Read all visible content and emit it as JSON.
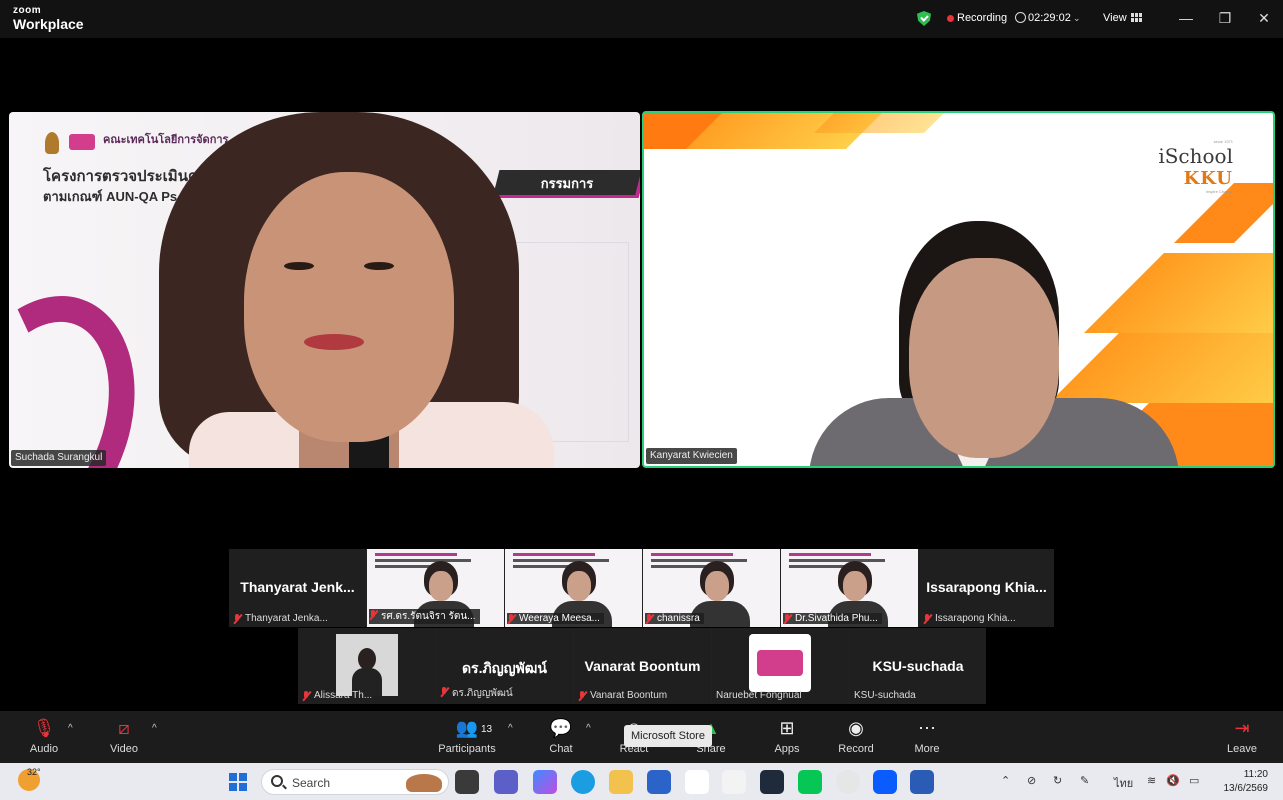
{
  "app": {
    "brand_top": "zoom",
    "brand_bottom": "Workplace"
  },
  "titlebar": {
    "recording_label": "Recording",
    "timer": "02:29:02",
    "view_label": "View",
    "minimize": "—",
    "restore": "❐",
    "close": "✕"
  },
  "main_tiles": [
    {
      "name": "Suchada Surangkul",
      "slide_faculty": "คณะเทคโนโลยีการจัดการ",
      "slide_line1": "โครงการตรวจประเมินคุณ",
      "slide_line1_tail": "s",
      "slide_line2": "ตามเกณฑ์ AUN-QA Ps",
      "badge": "กรรมการ"
    },
    {
      "name": "Kanyarat Kwiecien",
      "logo_small": "since 1971",
      "logo_line1": "iSchool",
      "logo_line2": "KKU",
      "logo_tag": "Inspire Change"
    }
  ],
  "strip_row1": [
    {
      "display": "Thanyarat  Jenk...",
      "label": "Thanyarat  Jenka..."
    },
    {
      "label": "รศ.ดร.รัตนจิรา รัตน..."
    },
    {
      "label": "Weeraya Meesa..."
    },
    {
      "label": "chanissra"
    },
    {
      "label": "Dr.Sivathida Phu..."
    },
    {
      "display": "Issarapong  Khia...",
      "label": "Issarapong  Khia..."
    }
  ],
  "strip_row2": [
    {
      "label": "Alissara Th..."
    },
    {
      "display": "ดร.ภิญญพัฒน์",
      "label": "ดร.ภิญญพัฒน์"
    },
    {
      "display": "Vanarat Boontum",
      "label": "Vanarat Boontum"
    },
    {
      "label": "Naruebet Fongnual"
    },
    {
      "display": "KSU-suchada",
      "label": "KSU-suchada"
    }
  ],
  "toolbar": {
    "audio": "Audio",
    "video": "Video",
    "participants": "Participants",
    "participants_count": "13",
    "chat": "Chat",
    "react": "React",
    "share": "Share",
    "apps": "Apps",
    "record": "Record",
    "more": "More",
    "leave": "Leave",
    "tooltip": "Microsoft Store"
  },
  "taskbar": {
    "temperature": "32°",
    "search_placeholder": "Search",
    "language": "ไทย",
    "time": "11:20",
    "date": "13/6/2569"
  },
  "colors": {
    "active_speaker_border": "#28d07a",
    "recording_dot": "#e8353b",
    "secure_shield": "#2fbf50",
    "accent_orange": "#ff9a1f",
    "accent_magenta": "#c3288f"
  }
}
